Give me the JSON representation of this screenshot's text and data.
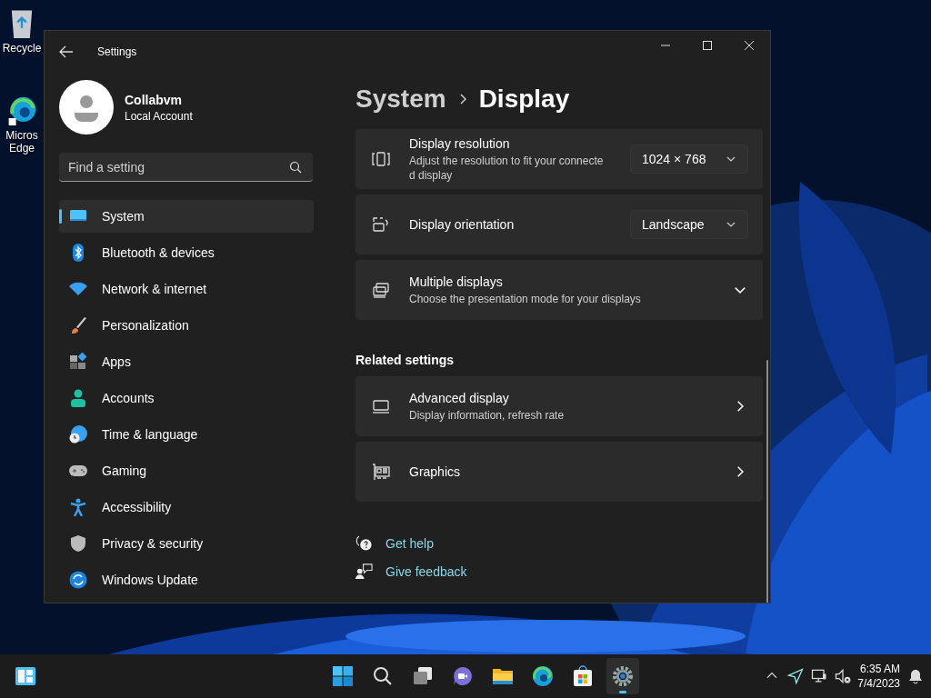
{
  "desktop_icons": [
    {
      "kind": "recycle",
      "lines": [
        "Recycle"
      ]
    },
    {
      "kind": "edge",
      "lines": [
        "Micros",
        "Edge"
      ]
    }
  ],
  "window": {
    "title": "Settings",
    "account": {
      "name": "Collabvm",
      "type": "Local Account"
    },
    "search": {
      "placeholder": "Find a setting"
    },
    "nav": [
      {
        "label": "System",
        "selected": true
      },
      {
        "label": "Bluetooth & devices",
        "selected": false
      },
      {
        "label": "Network & internet",
        "selected": false
      },
      {
        "label": "Personalization",
        "selected": false
      },
      {
        "label": "Apps",
        "selected": false
      },
      {
        "label": "Accounts",
        "selected": false
      },
      {
        "label": "Time & language",
        "selected": false
      },
      {
        "label": "Gaming",
        "selected": false
      },
      {
        "label": "Accessibility",
        "selected": false
      },
      {
        "label": "Privacy & security",
        "selected": false
      },
      {
        "label": "Windows Update",
        "selected": false
      }
    ],
    "breadcrumb": {
      "parent": "System",
      "current": "Display"
    },
    "cards": [
      {
        "title": "Display resolution",
        "description_lines": [
          "Adjust the resolution to fit your connecte",
          "d display"
        ],
        "control": {
          "kind": "dropdown",
          "value": "1024 × 768"
        }
      },
      {
        "title": "Display orientation",
        "control": {
          "kind": "dropdown",
          "value": "Landscape"
        }
      },
      {
        "title": "Multiple displays",
        "description_lines": [
          "Choose the presentation mode for your displays"
        ],
        "control": {
          "kind": "expand"
        }
      }
    ],
    "related_heading": "Related settings",
    "related": [
      {
        "title": "Advanced display",
        "description_lines": [
          "Display information, refresh rate"
        ],
        "control": {
          "kind": "chevron"
        }
      },
      {
        "title": "Graphics",
        "control": {
          "kind": "chevron"
        }
      }
    ],
    "links": [
      {
        "label": "Get help"
      },
      {
        "label": "Give feedback"
      }
    ]
  },
  "taskbar": {
    "center": [
      {
        "kind": "start",
        "active": false
      },
      {
        "kind": "search",
        "active": false
      },
      {
        "kind": "taskview",
        "active": false
      },
      {
        "kind": "chat",
        "active": false
      },
      {
        "kind": "explorer",
        "active": false
      },
      {
        "kind": "edge",
        "active": false
      },
      {
        "kind": "store",
        "active": false
      },
      {
        "kind": "settings",
        "active": true
      }
    ],
    "tray": [
      {
        "kind": "chevron"
      },
      {
        "kind": "location"
      },
      {
        "kind": "network"
      },
      {
        "kind": "volume-muted"
      }
    ],
    "time": "6:35 AM",
    "date": "7/4/2023"
  }
}
